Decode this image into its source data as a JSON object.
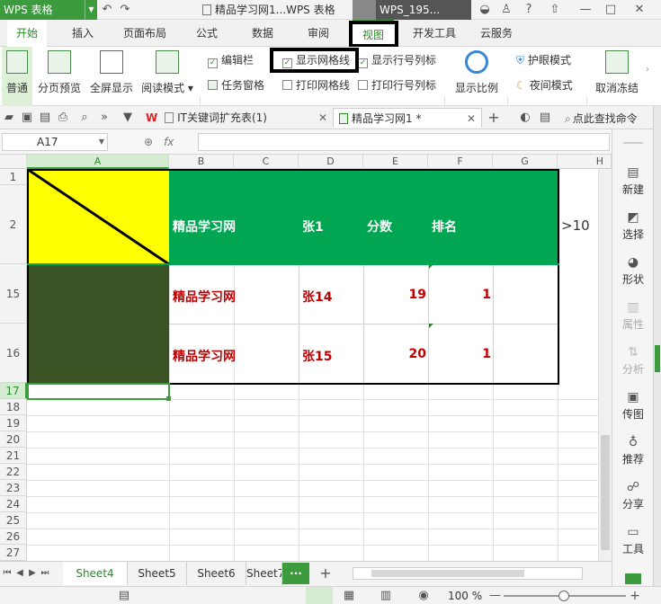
{
  "titlebar": {
    "app_name": "WPS 表格",
    "doc_title": "精品学习网1...WPS 表格",
    "user_name": "WPS_195...",
    "help_label": "?"
  },
  "ribbon_tabs": [
    "开始",
    "插入",
    "页面布局",
    "公式",
    "数据",
    "审阅",
    "视图",
    "开发工具",
    "云服务"
  ],
  "active_ribbon_tab": "视图",
  "ribbon": {
    "buttons": {
      "normal": "普通",
      "page_break_preview": "分页预览",
      "full_screen": "全屏显示",
      "reading_mode": "阅读模式",
      "zoom": "显示比例",
      "eye_protection": "护眼模式",
      "night_mode": "夜间模式",
      "unfreeze": "取消冻结"
    },
    "checkboxes": {
      "formula_bar": {
        "label": "编辑栏",
        "checked": true
      },
      "show_gridlines": {
        "label": "显示网格线",
        "checked": true
      },
      "show_headers": {
        "label": "显示行号列标",
        "checked": true
      },
      "task_pane": {
        "label": "任务窗格",
        "checked": true
      },
      "print_gridlines": {
        "label": "打印网格线",
        "checked": false
      },
      "print_headers": {
        "label": "打印行号列标",
        "checked": false
      }
    }
  },
  "document_tabs": [
    {
      "label": "IT关键词扩充表(1)",
      "active": false
    },
    {
      "label": "精品学习网1 *",
      "active": true
    }
  ],
  "doc_toolbar": {
    "search_label": "点此查找命令"
  },
  "formula_bar": {
    "name_box": "A17",
    "fx": "fx",
    "content": ""
  },
  "columns": [
    "A",
    "B",
    "C",
    "D",
    "E",
    "F",
    "G",
    "H"
  ],
  "rows": {
    "r1": "1",
    "r2": "2",
    "r15": "15",
    "r16": "16",
    "r17": "17",
    "r18": "18",
    "r19": "19",
    "r20": "20",
    "r21": "21",
    "r22": "22",
    "r23": "23",
    "r24": "24",
    "r25": "25",
    "r26": "26",
    "r27": "27"
  },
  "cells": {
    "row2": {
      "b": "精品学习网",
      "d": "张1",
      "e": "分数",
      "f": "排名",
      "h": ">10"
    },
    "row15": {
      "b": "精品学习网",
      "d": "张14",
      "e": "19",
      "f": "1"
    },
    "row16": {
      "b": "精品学习网",
      "d": "张15",
      "e": "20",
      "f": "1"
    }
  },
  "colors": {
    "header_fill": "#00a651",
    "diagonal_cell": "#ffff00",
    "dark_green": "#3a5224",
    "data_text": "#c00000",
    "accent": "#3c9b3c"
  },
  "sheet_tabs": [
    {
      "label": "Sheet4",
      "active": true
    },
    {
      "label": "Sheet5",
      "active": false
    },
    {
      "label": "Sheet6",
      "active": false
    },
    {
      "label": "Sheet7",
      "active": false
    }
  ],
  "sheet_more": "···",
  "sheet_add": "+",
  "status_bar": {
    "zoom": "100 %"
  },
  "side_panel": [
    {
      "label": "新建",
      "icon": "new-icon",
      "enabled": true
    },
    {
      "label": "选择",
      "icon": "select-icon",
      "enabled": true
    },
    {
      "label": "形状",
      "icon": "shape-icon",
      "enabled": true
    },
    {
      "label": "属性",
      "icon": "properties-icon",
      "enabled": false
    },
    {
      "label": "分析",
      "icon": "analysis-icon",
      "enabled": false
    },
    {
      "label": "传图",
      "icon": "upload-image-icon",
      "enabled": true
    },
    {
      "label": "推荐",
      "icon": "recommend-icon",
      "enabled": true
    },
    {
      "label": "分享",
      "icon": "share-icon",
      "enabled": true
    },
    {
      "label": "工具",
      "icon": "toolbox-icon",
      "enabled": true
    }
  ]
}
